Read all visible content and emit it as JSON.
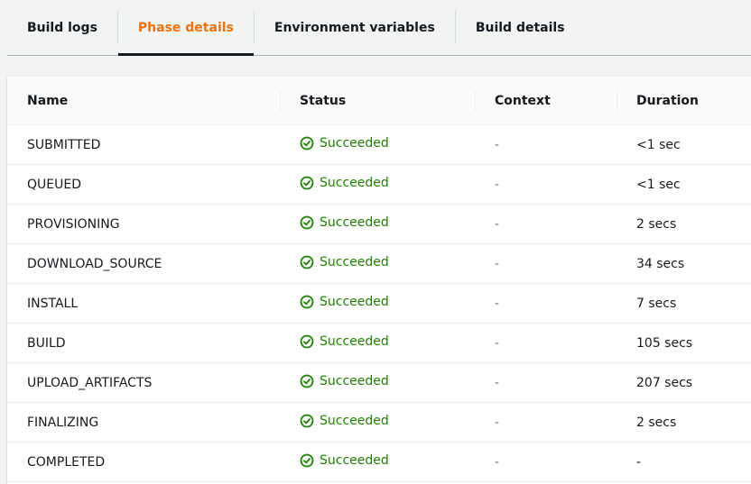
{
  "tabs": [
    {
      "label": "Build logs",
      "active": false
    },
    {
      "label": "Phase details",
      "active": true
    },
    {
      "label": "Environment variables",
      "active": false
    },
    {
      "label": "Build details",
      "active": false
    }
  ],
  "colors": {
    "active_tab": "#ec7211",
    "success": "#1d8102"
  },
  "table": {
    "columns": [
      "Name",
      "Status",
      "Context",
      "Duration"
    ],
    "rows": [
      {
        "name": "SUBMITTED",
        "status": "Succeeded",
        "context": "-",
        "duration": "<1 sec"
      },
      {
        "name": "QUEUED",
        "status": "Succeeded",
        "context": "-",
        "duration": "<1 sec"
      },
      {
        "name": "PROVISIONING",
        "status": "Succeeded",
        "context": "-",
        "duration": "2 secs"
      },
      {
        "name": "DOWNLOAD_SOURCE",
        "status": "Succeeded",
        "context": "-",
        "duration": "34 secs"
      },
      {
        "name": "INSTALL",
        "status": "Succeeded",
        "context": "-",
        "duration": "7 secs"
      },
      {
        "name": "BUILD",
        "status": "Succeeded",
        "context": "-",
        "duration": "105 secs"
      },
      {
        "name": "UPLOAD_ARTIFACTS",
        "status": "Succeeded",
        "context": "-",
        "duration": "207 secs"
      },
      {
        "name": "FINALIZING",
        "status": "Succeeded",
        "context": "-",
        "duration": "2 secs"
      },
      {
        "name": "COMPLETED",
        "status": "Succeeded",
        "context": "-",
        "duration": "-"
      }
    ]
  },
  "icons": {
    "status": "check-circle-icon"
  }
}
